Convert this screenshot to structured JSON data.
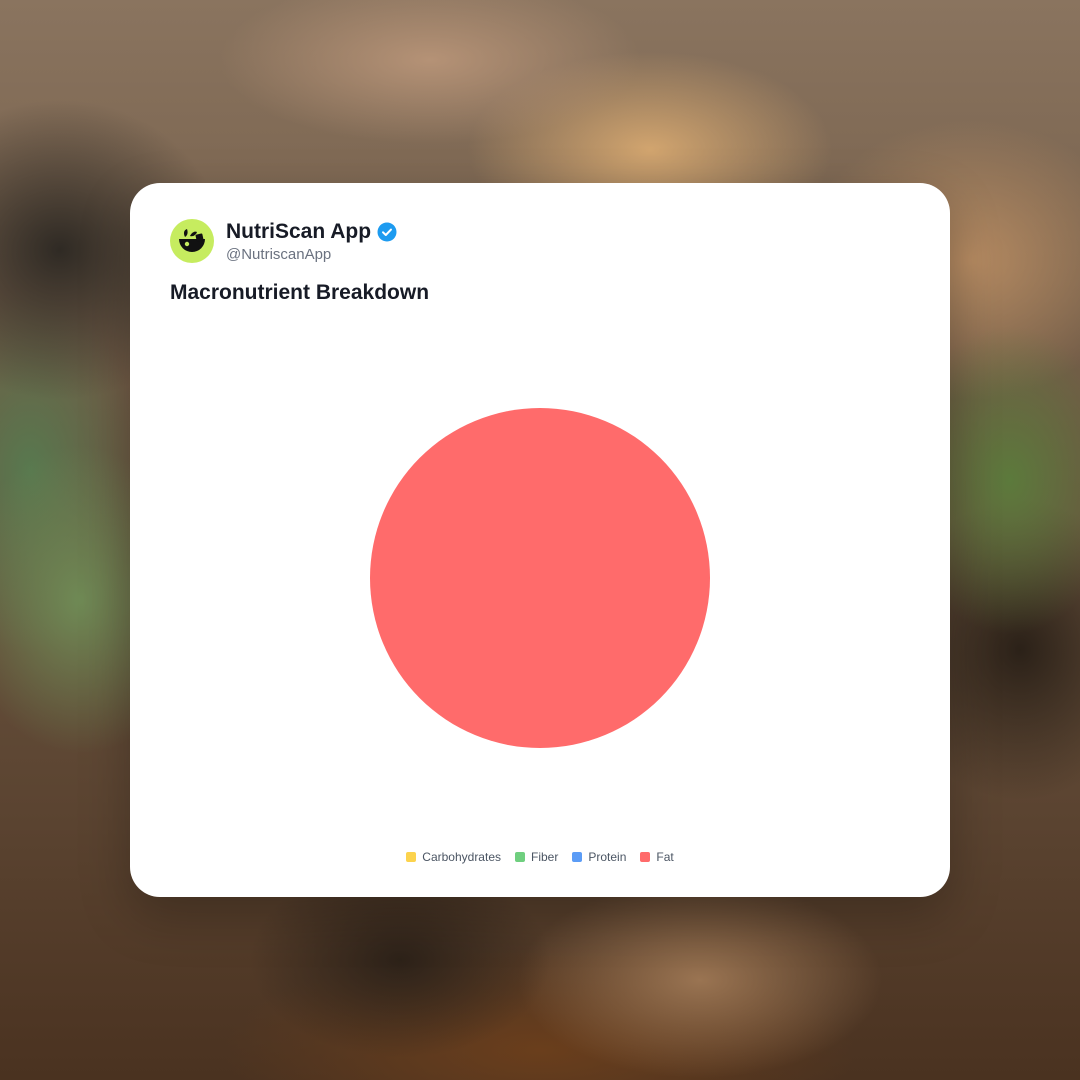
{
  "account": {
    "name": "NutriScan App",
    "handle": "@NutriscanApp",
    "verified": true,
    "avatar_icon": "nutriscan-logo-icon",
    "avatar_color": "#c6ec5f",
    "verified_color": "#1d9bf0"
  },
  "chart_data": {
    "type": "pie",
    "title": "Macronutrient Breakdown",
    "categories": [
      "Carbohydrates",
      "Fiber",
      "Protein",
      "Fat"
    ],
    "values": [
      0,
      0,
      0,
      100
    ],
    "colors": [
      "#fcd34d",
      "#6fcf7f",
      "#5b9cf6",
      "#ff6b6b"
    ],
    "legend": "bottom"
  }
}
